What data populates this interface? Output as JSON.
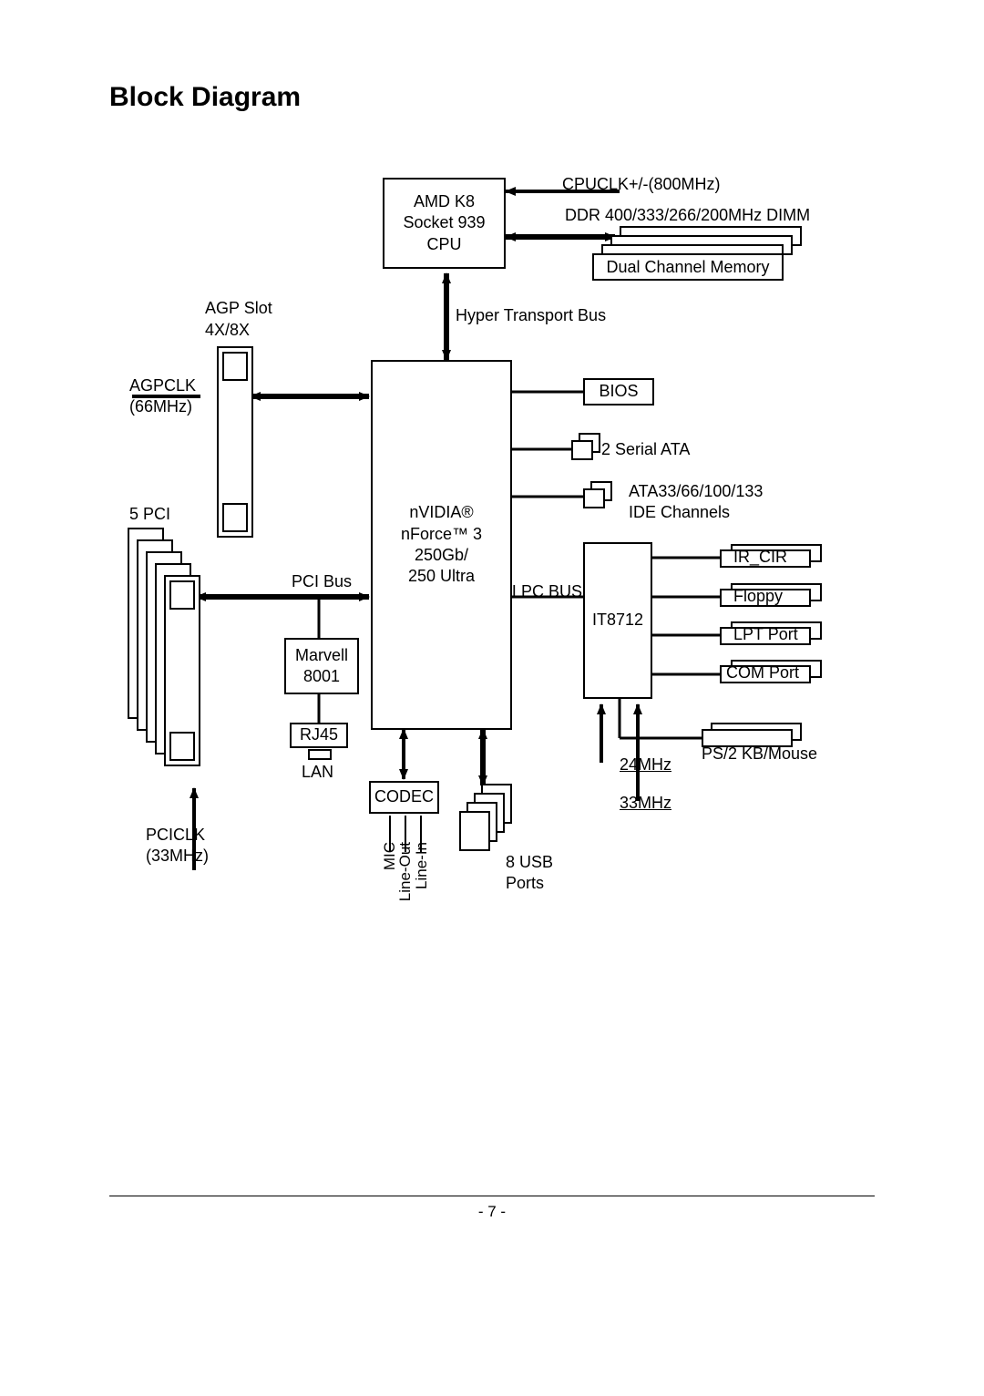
{
  "title": "Block Diagram",
  "cpu": {
    "line1": "AMD K8",
    "line2": "Socket 939",
    "line3": "CPU"
  },
  "cpuclk": "CPUCLK+/-(800MHz)",
  "ddr": "DDR 400/333/266/200MHz DIMM",
  "dual_channel": "Dual Channel Memory",
  "hyper_transport": "Hyper Transport Bus",
  "agp_slot": {
    "line1": "AGP Slot",
    "line2": "4X/8X"
  },
  "agpclk": {
    "line1": "AGPCLK",
    "line2": "(66MHz)"
  },
  "pci5": "5 PCI",
  "pciclk": {
    "line1": "PCICLK",
    "line2": "(33MHz)"
  },
  "chipset": {
    "line1": "nVIDIA®",
    "line2": "nForce™ 3",
    "line3": "250Gb/",
    "line4": "250 Ultra"
  },
  "bios": "BIOS",
  "sata": "2 Serial ATA",
  "ata": {
    "line1": "ATA33/66/100/133",
    "line2": "IDE Channels"
  },
  "ir": "IR_CIR",
  "floppy": "Floppy",
  "lpt": "LPT Port",
  "com": "COM Port",
  "ps2": "PS/2 KB/Mouse",
  "it8712": "IT8712",
  "clk24": "24MHz",
  "clk33": "33MHz",
  "lpc": "LPC BUS",
  "pcibus": "PCI Bus",
  "marvell": {
    "line1": "Marvell",
    "line2": "8001"
  },
  "rj45": "RJ45",
  "lan": "LAN",
  "codec": "CODEC",
  "usb": {
    "line1": "8 USB",
    "line2": "Ports"
  },
  "audio": {
    "mic": "MIC",
    "lineout": "Line-Out",
    "linein": "Line-In"
  },
  "page_number": "- 7 -"
}
